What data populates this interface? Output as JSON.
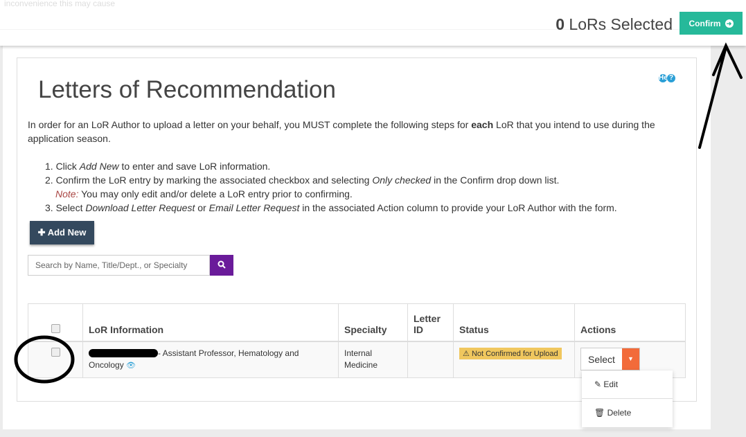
{
  "header": {
    "faded_text": "inconvenience this may cause",
    "selected_count": "0",
    "selected_label": "LoRs Selected",
    "confirm_label": "Confirm",
    "confirm_icon": "arrow-circle-right-icon"
  },
  "page": {
    "title": "Letters of Recommendation",
    "help_label": "Help",
    "help_icon": "question-circle-icon",
    "intro_before": "In order for an LoR Author to upload a letter on your behalf, you MUST complete the following steps for ",
    "intro_bold": "each",
    "intro_after": " LoR that you intend to use during the application season.",
    "steps": [
      {
        "a": "1. Click ",
        "em": "Add New",
        "b": " to enter and save LoR information."
      },
      {
        "a": "2. Confirm the LoR entry by marking the associated checkbox and selecting ",
        "em": "Only checked",
        "b": " in the Confirm drop down list."
      },
      {
        "note": "Note:",
        "b": " You may only edit and/or delete a LoR entry prior to confirming."
      },
      {
        "a": "3. Select ",
        "em": "Download Letter Request",
        "b": " or ",
        "em2": "Email Letter Request",
        "c": " in the associated Action column to provide your LoR Author with the form."
      }
    ],
    "add_new_label": "Add New",
    "search_placeholder": "Search by Name, Title/Dept., or Specialty"
  },
  "table": {
    "headers": [
      "LoR Information",
      "Specialty",
      "Letter ID",
      "Status",
      "Actions"
    ],
    "rows": [
      {
        "info": "- Assistant Professor, Hematology and Oncology",
        "specialty": "Internal Medicine",
        "letter_id": "",
        "status": "Not Confirmed for Upload",
        "action": "Select"
      }
    ]
  },
  "dropdown": {
    "items": [
      "Edit",
      "Delete"
    ]
  },
  "colors": {
    "confirm": "#26b99a",
    "add_new": "#34495e",
    "search_button": "#6a1b9a",
    "action_caret": "#f26b3a",
    "status_badge": "#f0c75e",
    "link": "#2a9fd6"
  }
}
